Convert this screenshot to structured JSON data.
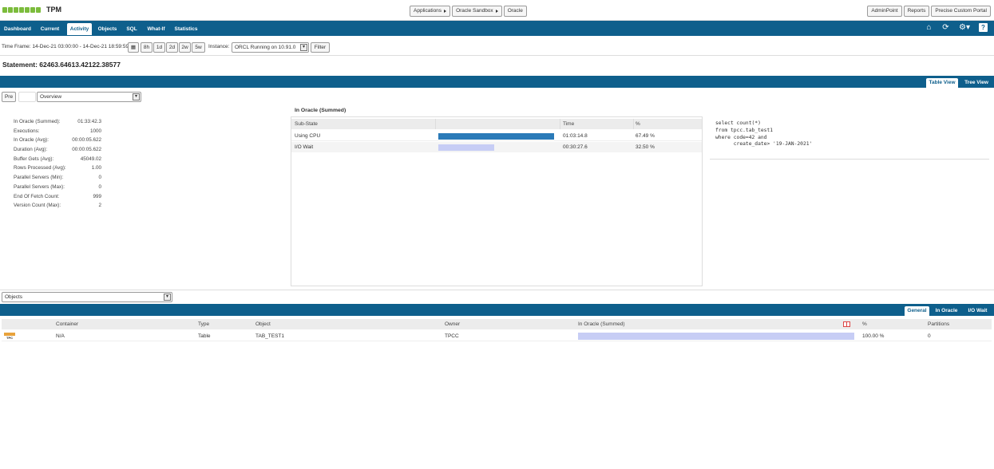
{
  "app": {
    "brand": "precise",
    "title": "TPM"
  },
  "breadcrumbs": [
    "Applications",
    "Oracle Sandbox",
    "Oracle"
  ],
  "top_links": [
    "AdminPoint",
    "Reports",
    "Precise Custom Portal"
  ],
  "nav_tabs": [
    "Dashboard",
    "Current",
    "Activity",
    "Objects",
    "SQL",
    "What-If",
    "Statistics"
  ],
  "nav_active": "Activity",
  "toolbar": {
    "time_frame": "Time Frame: 14-Dec-21 03:00:00 - 14-Dec-21 18:59:59",
    "ranges": [
      "8h",
      "1d",
      "2d",
      "2w",
      "5w"
    ],
    "instance_label": "Instance:",
    "instance_value": "ORCL Running on 10.91.0",
    "filter": "Filter"
  },
  "statement": "Statement: 62463.64613.42122.38577",
  "view_tabs": [
    "Table View",
    "Tree View"
  ],
  "pre_button": "Pre",
  "overview_select": "Overview",
  "stats": [
    {
      "label": "In Oracle (Summed):",
      "value": "01:33:42.3"
    },
    {
      "label": "Executions:",
      "value": "1000"
    },
    {
      "label": "In Oracle (Avg):",
      "value": "00:00:05.622"
    },
    {
      "label": "Duration (Avg):",
      "value": "00:00:05.622"
    },
    {
      "label": "Buffer Gets (Avg):",
      "value": "45049.02"
    },
    {
      "label": "Rows Processed (Avg):",
      "value": "1.00"
    },
    {
      "label": "Parallel Servers (Min):",
      "value": "0"
    },
    {
      "label": "Parallel Servers (Max):",
      "value": "0"
    },
    {
      "label": "End Of Fetch Count:",
      "value": "999"
    },
    {
      "label": "Version Count (Max):",
      "value": "2"
    }
  ],
  "in_oracle": {
    "title": "In Oracle (Summed)",
    "headers": [
      "Sub-State",
      "",
      "Time",
      "%"
    ],
    "rows": [
      {
        "state": "Using CPU",
        "time": "01:03:14.8",
        "pct": "67.49 %",
        "fraction": 0.6749,
        "color": "#2a7ab8"
      },
      {
        "state": "I/O Wait",
        "time": "00:30:27.6",
        "pct": "32.50 %",
        "fraction": 0.325,
        "color": "#c7cdf5"
      }
    ]
  },
  "sql_text": "select count(*)\nfrom tpcc.tab_test1\nwhere code=42 and\n      create_date> '19-JAN-2021'",
  "objects_select": "Objects",
  "object_tabs": [
    "General",
    "In Oracle",
    "I/O Wait"
  ],
  "objects_table": {
    "headers": [
      "Container",
      "Type",
      "Object",
      "Owner",
      "In Oracle (Summed)",
      "%",
      "Partitions"
    ],
    "rows": [
      {
        "icon_text": "TPC",
        "container": "N/A",
        "type": "Table",
        "object": "TAB_TEST1",
        "owner": "TPCC",
        "fraction": 1.0,
        "pct": "100.00 %",
        "partitions": "0"
      }
    ]
  },
  "colors": {
    "nav": "#0e5f8c",
    "brand_green": "#7cbc3c",
    "cpu": "#2a7ab8",
    "io": "#c7cdf5"
  }
}
